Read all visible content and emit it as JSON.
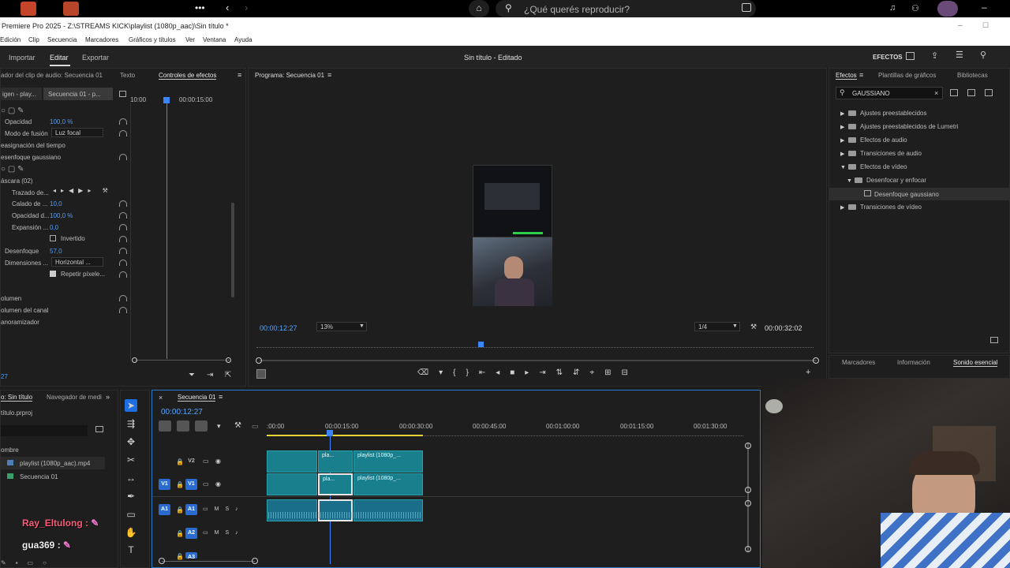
{
  "spotify": {
    "search_placeholder": "¿Qué querés reproducir?",
    "more": "•••"
  },
  "titlebar": {
    "title": "Premiere Pro 2025 - Z:\\STREAMS KICK\\playlist (1080p_aac)\\Sin título *"
  },
  "menu": [
    "Edición",
    "Clip",
    "Secuencia",
    "Marcadores",
    "Gráficos y títulos",
    "Ver",
    "Ventana",
    "Ayuda"
  ],
  "header": {
    "tabs": [
      "Importar",
      "Editar",
      "Exportar"
    ],
    "project_title": "Sin título - Editado",
    "effects_label": "EFECTOS"
  },
  "effect_controls": {
    "tabs": [
      "ador del clip de audio: Secuencia 01",
      "Texto",
      "Controles de efectos"
    ],
    "source": "igen - play...",
    "sequence": "Secuencia 01 - p...",
    "timecodes": [
      "10:00",
      "00:00:15:00"
    ],
    "rows": [
      {
        "label": "Opacidad",
        "value": "100,0 %"
      },
      {
        "label": "Modo de fusión",
        "value": "Luz focal"
      },
      {
        "label": "easignación del tiempo",
        "value": ""
      },
      {
        "label": "esenfoque gaussiano",
        "value": ""
      },
      {
        "label": "áscara (02)",
        "value": ""
      },
      {
        "label": "Trazado de...",
        "value": ""
      },
      {
        "label": "Calado de ...",
        "value": "10,0"
      },
      {
        "label": "Opacidad d...",
        "value": "100,0 %"
      },
      {
        "label": "Expansión ...",
        "value": "0,0"
      },
      {
        "label": "Invertido",
        "value": ""
      },
      {
        "label": "Desenfoque",
        "value": "57,0"
      },
      {
        "label": "Dimensiones ...",
        "value": "Horizontal ..."
      },
      {
        "label": "Repetir píxele...",
        "value": ""
      },
      {
        "label": "olumen",
        "value": ""
      },
      {
        "label": "olumen del canal",
        "value": ""
      },
      {
        "label": "anoramizador",
        "value": ""
      }
    ],
    "bottom_timecode": "27"
  },
  "program": {
    "tab": "Programa: Secuencia 01",
    "timecode": "00:00:12:27",
    "zoom": "13%",
    "quality": "1/4",
    "duration": "00:00:32:02"
  },
  "effects_panel": {
    "tabs": [
      "Efectos",
      "Plantillas de gráficos",
      "Bibliotecas"
    ],
    "search_value": "GAUSSIANO",
    "tree": [
      {
        "label": "Ajustes preestablecidos",
        "level": 0,
        "open": false
      },
      {
        "label": "Ajustes preestablecidos de Lumetri",
        "level": 0,
        "open": false
      },
      {
        "label": "Efectos de audio",
        "level": 0,
        "open": false
      },
      {
        "label": "Transiciones de audio",
        "level": 0,
        "open": false
      },
      {
        "label": "Efectos de vídeo",
        "level": 0,
        "open": true
      },
      {
        "label": "Desenfocar y enfocar",
        "level": 1,
        "open": true
      },
      {
        "label": "Desenfoque gaussiano",
        "level": 2,
        "open": false
      },
      {
        "label": "Transiciones de vídeo",
        "level": 0,
        "open": false
      }
    ],
    "bottom_tabs": [
      "Marcadores",
      "Información",
      "Sonido esencial"
    ]
  },
  "project": {
    "tabs": [
      "o: Sin título",
      "Navegador de medi"
    ],
    "file": "título.prproj",
    "name_header": "ombre",
    "items": [
      "playlist (1080p_aac).mp4",
      "Secuencia 01"
    ]
  },
  "chat": [
    {
      "user": "Ray_Eltulong",
      "color": "#ff5a7a"
    },
    {
      "user": "gua369",
      "color": "#f0f0f0"
    }
  ],
  "timeline": {
    "tab": "Secuencia 01",
    "timecode": "00:00:12:27",
    "ruler": [
      ":00:00",
      "00:00:15:00",
      "00:00:30:00",
      "00:00:45:00",
      "00:01:00:00",
      "00:01:15:00",
      "00:01:30:00"
    ],
    "clip_label": "playlist (1080p_...",
    "clip_short": "pla...",
    "tracks": [
      "V2",
      "V1",
      "A1",
      "A2",
      "A3"
    ]
  }
}
